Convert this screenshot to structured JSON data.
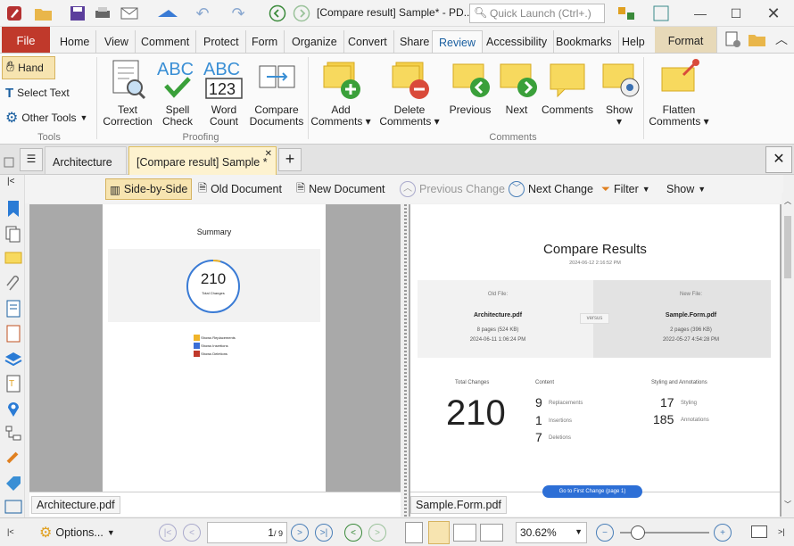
{
  "window": {
    "title": "[Compare result] Sample* - PD...",
    "search_placeholder": "Quick Launch (Ctrl+.)"
  },
  "ribbon_tabs": [
    "File",
    "Home",
    "View",
    "Comment",
    "Protect",
    "Form",
    "Organize",
    "Convert",
    "Share",
    "Review",
    "Accessibility",
    "Bookmarks",
    "Help",
    "Format"
  ],
  "tools": {
    "hand": "Hand",
    "select_text": "Select Text",
    "other_tools": "Other Tools",
    "label": "Tools"
  },
  "proofing": {
    "text_correction": [
      "Text",
      "Correction"
    ],
    "spell_check": [
      "Spell",
      "Check"
    ],
    "word_count": [
      "Word",
      "Count"
    ],
    "compare": [
      "Compare",
      "Documents"
    ],
    "label": "Proofing"
  },
  "comments": {
    "add": [
      "Add",
      "Comments"
    ],
    "delete": [
      "Delete",
      "Comments"
    ],
    "previous": "Previous",
    "next": "Next",
    "comments": "Comments",
    "show": "Show",
    "flatten": [
      "Flatten",
      "Comments"
    ],
    "label": "Comments"
  },
  "doc_tabs": [
    "Architecture",
    "[Compare result] Sample *"
  ],
  "compare_bar": {
    "side_by_side": "Side-by-Side",
    "old_doc": "Old Document",
    "new_doc": "New Document",
    "prev_change": "Previous Change",
    "next_change": "Next Change",
    "filter": "Filter",
    "show": "Show"
  },
  "left_page": {
    "title": "Summary",
    "number": "210",
    "caption": "Total Changes",
    "legend": [
      "Shows Replacements",
      "Shows Insertions",
      "Shows Deletions"
    ],
    "legend_colors": [
      "#f0b429",
      "#3b6fd6",
      "#c0392b"
    ],
    "file": "Architecture.pdf"
  },
  "right_page": {
    "title": "Compare Results",
    "date": "2024-06-12 2:16:52 PM",
    "old_label": "Old File:",
    "old_name": "Architecture.pdf",
    "old_pages": "8 pages (524 KB)",
    "old_date": "2024-06-11 1:06:24 PM",
    "versus": "versus",
    "new_label": "New File:",
    "new_name": "Sample.Form.pdf",
    "new_pages": "2 pages (396 KB)",
    "new_date": "2022-05-27 4:54:28 PM",
    "total_label": "Total Changes",
    "total": "210",
    "content_label": "Content",
    "replacements": "9",
    "replacements_label": "Replacements",
    "insertions": "1",
    "insertions_label": "Insertions",
    "deletions": "7",
    "deletions_label": "Deletions",
    "styling_label": "Styling and Annotations",
    "styling": "17",
    "styling_word": "Styling",
    "annotations": "185",
    "annotations_word": "Annotations",
    "goto": "Go to First Change (page 1)",
    "file": "Sample.Form.pdf"
  },
  "status": {
    "options": "Options...",
    "page": "1",
    "page_total": "/ 9",
    "zoom": "30.62%"
  },
  "colors": {
    "accent": "#1a5fa0",
    "file_tab": "#c0392b",
    "ring": "#3a7bd5"
  }
}
